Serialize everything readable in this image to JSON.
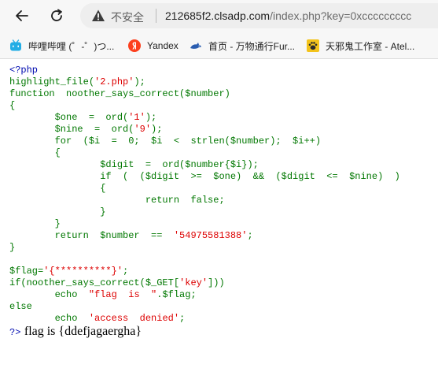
{
  "browser": {
    "security_label": "不安全",
    "url_host": "212685f2.clsadp.com",
    "url_rest": "/index.php?key=0xccccccccc"
  },
  "bookmarks": [
    {
      "label": "哔哩哔哩 (゜-゜)つ...",
      "icon": "bilibili-icon",
      "color": "#23ade5"
    },
    {
      "label": "Yandex",
      "icon": "yandex-icon",
      "color": "#fc3f1d"
    },
    {
      "label": "首页 - 万物通行Fur...",
      "icon": "wolf-icon",
      "color": "#2a5db0"
    },
    {
      "label": "天邪鬼工作室 - Atel...",
      "icon": "paw-icon",
      "color": "#2b2b2b"
    }
  ],
  "code": {
    "lines": [
      "<?php",
      "highlight_file('2.php');",
      "function  noother_says_correct($number)",
      "{",
      "        $one  =  ord('1');",
      "        $nine  =  ord('9');",
      "        for  ($i  =  0;  $i  <  strlen($number);  $i++)",
      "        {",
      "                $digit  =  ord($number{$i});",
      "                if  (  ($digit  >=  $one)  &&  ($digit  <=  $nine)  )",
      "                {",
      "                        return  false;",
      "                }",
      "        }",
      "        return  $number  ==  '54975581388';",
      "}",
      "",
      "$flag='{**********}';",
      "if(noother_says_correct($_GET['key']))",
      "        echo  \"flag  is  \".$flag;",
      "else",
      "        echo  'access  denied';"
    ],
    "close_tag": "?>",
    "output": "flag is {ddefjagaergha}"
  }
}
